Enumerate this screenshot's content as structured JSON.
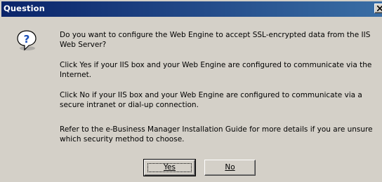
{
  "window": {
    "title": "Question",
    "close_icon": "close-icon"
  },
  "icon": {
    "name": "question-icon",
    "glyph": "?",
    "color": "#1a4fb8"
  },
  "message": {
    "paragraphs": [
      "Do you want to configure the Web Engine to accept SSL-encrypted data from the IIS\nWeb Server?",
      "Click Yes if your IIS box and your Web Engine are configured to communicate via the\nInternet.",
      "Click No if your IIS box and your Web Engine are configured to communicate via a\nsecure intranet or dial-up connection.",
      "Refer to the e-Business Manager Installation Guide for more details if you are unsure\nwhich security method to choose."
    ]
  },
  "buttons": {
    "yes_label": "Yes",
    "no_label": "No"
  },
  "colors": {
    "titlebar_start": "#0a246a",
    "titlebar_end": "#3a6ea5",
    "face": "#d4d0c8"
  }
}
